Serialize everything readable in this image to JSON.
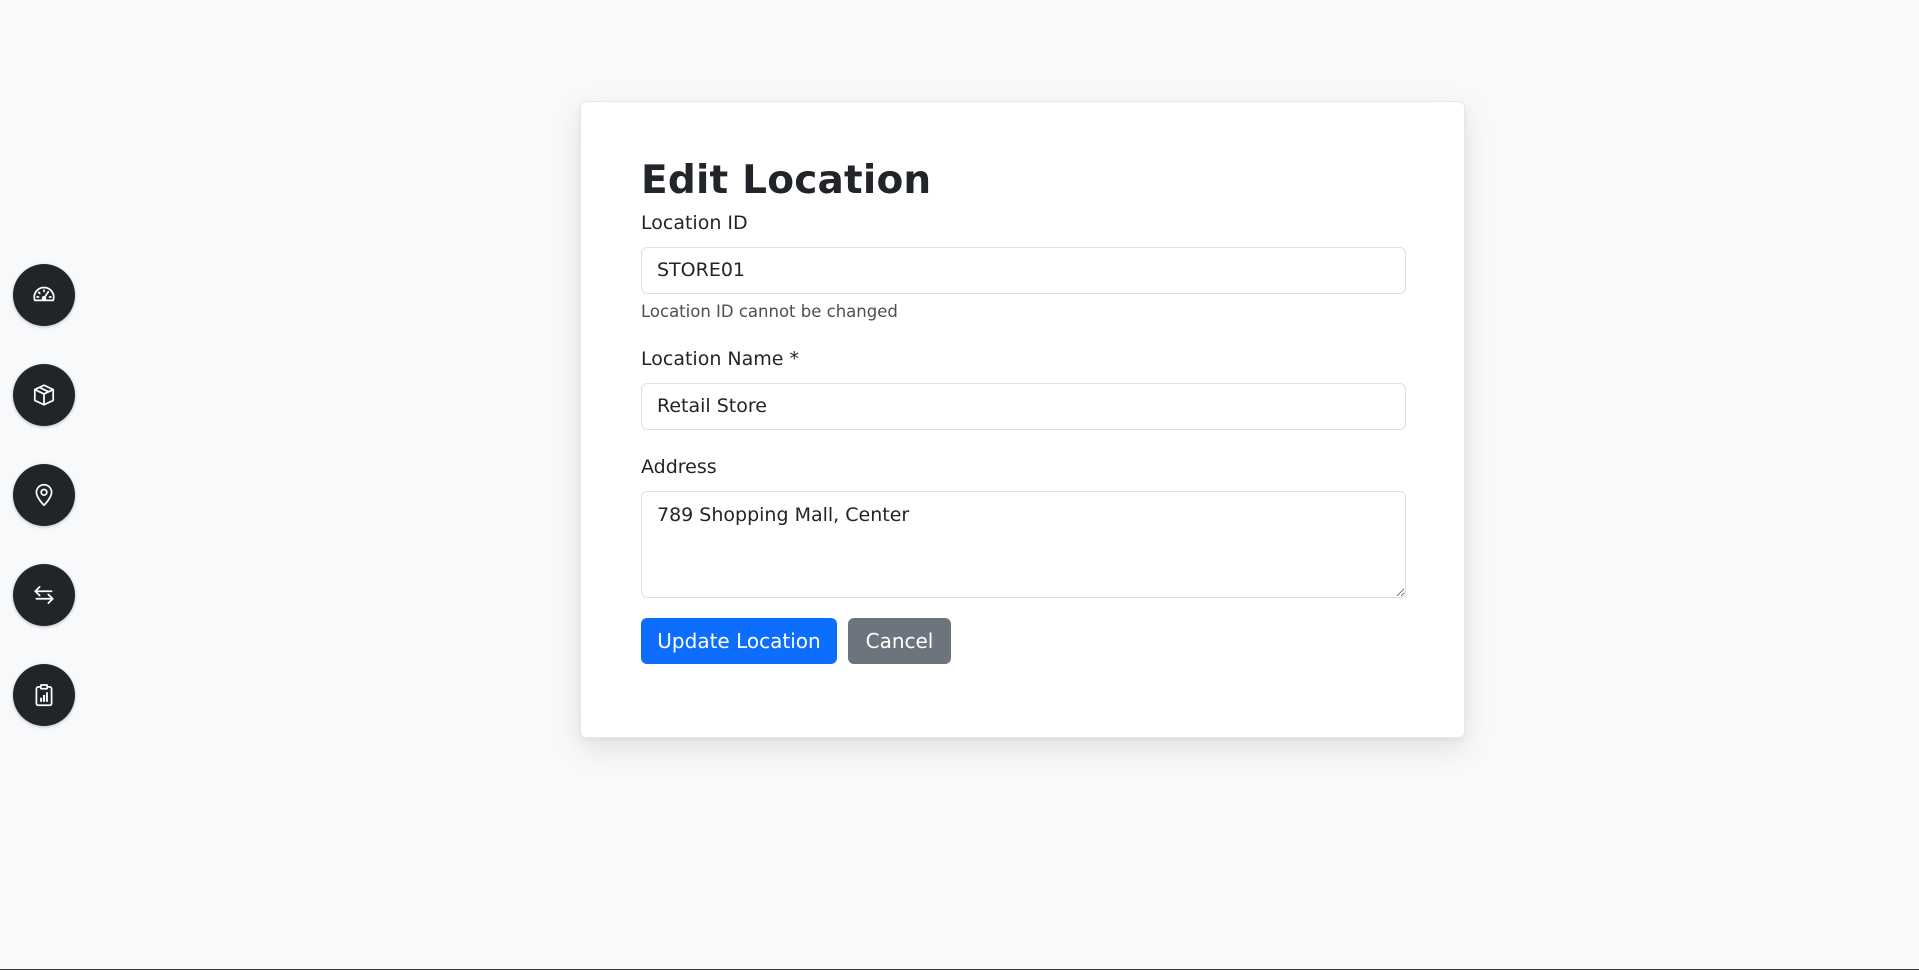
{
  "sidebar": {
    "items": [
      {
        "name": "dashboard",
        "icon": "speedometer-icon"
      },
      {
        "name": "products",
        "icon": "box-icon"
      },
      {
        "name": "locations",
        "icon": "map-pin-icon"
      },
      {
        "name": "transfers",
        "icon": "arrows-exchange-icon"
      },
      {
        "name": "reports",
        "icon": "clipboard-chart-icon"
      }
    ]
  },
  "form": {
    "title": "Edit Location",
    "location_id": {
      "label": "Location ID",
      "value": "STORE01",
      "help": "Location ID cannot be changed"
    },
    "location_name": {
      "label": "Location Name *",
      "value": "Retail Store"
    },
    "address": {
      "label": "Address",
      "value": "789 Shopping Mall, Center"
    },
    "submit_label": "Update Location",
    "cancel_label": "Cancel"
  },
  "colors": {
    "background": "#f8f9fa",
    "sidebar_button": "#212529",
    "primary": "#0d6efd",
    "secondary": "#6c757d"
  }
}
